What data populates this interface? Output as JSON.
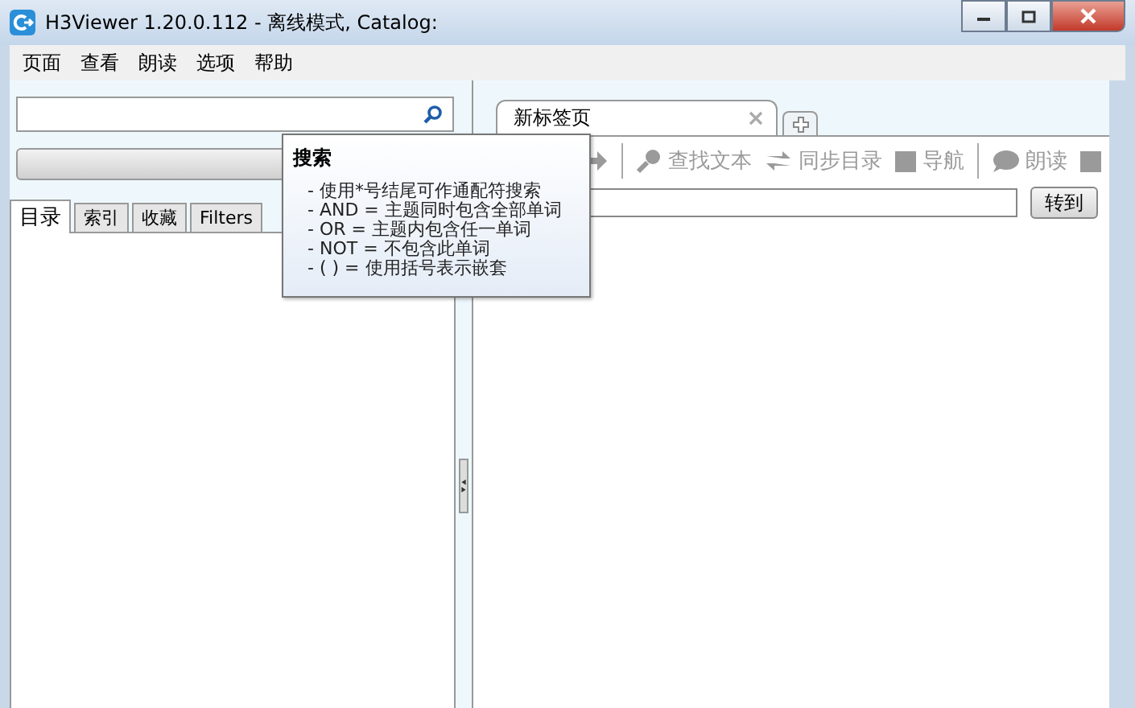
{
  "window": {
    "title": "H3Viewer 1.20.0.112 - 离线模式, Catalog:"
  },
  "menu": [
    "页面",
    "查看",
    "朗读",
    "选项",
    "帮助"
  ],
  "left_tabs": [
    {
      "label": "目录",
      "selected": true
    },
    {
      "label": "索引",
      "selected": false
    },
    {
      "label": "收藏",
      "selected": false
    },
    {
      "label": "Filters",
      "selected": false
    }
  ],
  "doc_tabs": [
    {
      "label": "新标签页",
      "selected": true
    }
  ],
  "toolbar": [
    {
      "kind": "forward",
      "disabled": true
    },
    {
      "kind": "sep"
    },
    {
      "kind": "key",
      "label": "查找文本",
      "disabled": true
    },
    {
      "kind": "sync",
      "label": "同步目录",
      "disabled": true
    },
    {
      "kind": "square",
      "label": "导航",
      "disabled": true
    },
    {
      "kind": "sep"
    },
    {
      "kind": "bubble",
      "label": "朗读",
      "disabled": true
    },
    {
      "kind": "square",
      "disabled": true
    }
  ],
  "goto_button": "转到",
  "tooltip": {
    "title": "搜索",
    "lines": [
      "- 使用*号结尾可作通配符搜索",
      "- AND = 主题同时包含全部单词",
      "- OR = 主题内包含任一单词",
      "- NOT = 不包含此单词",
      "- ( ) = 使用括号表示嵌套"
    ]
  }
}
